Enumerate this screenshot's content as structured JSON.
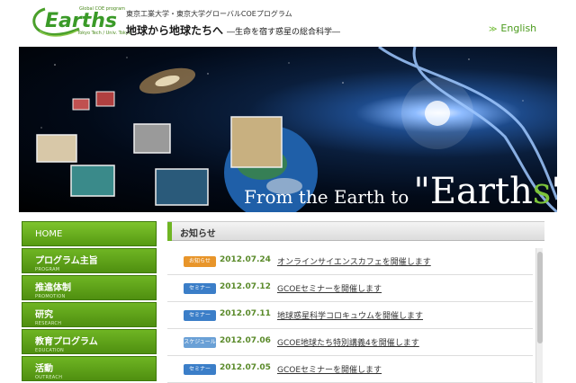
{
  "header": {
    "logo": {
      "small_top": "Global COE program",
      "word": "Earths",
      "sub": "Tokyo Tech / Univ. Tokyo"
    },
    "program_line": "東京工業大学・東京大学グローバルCOEプログラム",
    "tagline_main": "地球から地球たちへ",
    "tagline_sub": "―生命を宿す惑星の総合科学―",
    "english_link": "English",
    "english_icon": "double-chevron-right-icon"
  },
  "banner": {
    "title_small": "From the Earth to",
    "title_big_open": "\"Earth",
    "title_big_green": "s",
    "title_big_close": "\"",
    "accent_color": "#7cc43a"
  },
  "sidebar": {
    "items": [
      {
        "label": "HOME",
        "sub": ""
      },
      {
        "label": "プログラム主旨",
        "sub": "PROGRAM"
      },
      {
        "label": "推進体制",
        "sub": "PROMOTION"
      },
      {
        "label": "研究",
        "sub": "RESEARCH"
      },
      {
        "label": "教育プログラム",
        "sub": "EDUCATION"
      },
      {
        "label": "活動",
        "sub": "OUTREACH"
      }
    ]
  },
  "news": {
    "title": "お知らせ",
    "items": [
      {
        "badge": "お知らせ",
        "date": "2012.07.24",
        "text": "オンラインサイエンスカフェを開催します"
      },
      {
        "badge": "セミナー",
        "date": "2012.07.12",
        "text": "GCOEセミナーを開催します"
      },
      {
        "badge": "セミナー",
        "date": "2012.07.11",
        "text": "地球惑星科学コロキュウムを開催します"
      },
      {
        "badge": "スケジュール",
        "date": "2012.07.06",
        "text": "GCOE地球たち特別講義4を開催します"
      },
      {
        "badge": "セミナー",
        "date": "2012.07.05",
        "text": "GCOEセミナーを開催します"
      }
    ]
  }
}
